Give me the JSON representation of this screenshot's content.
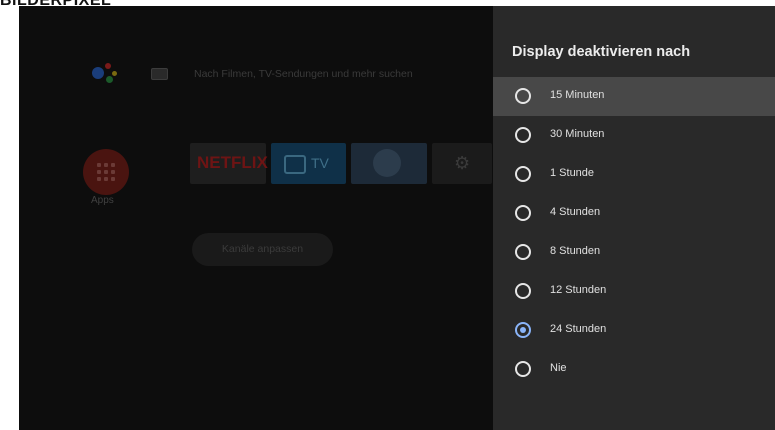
{
  "top_text": "BILDERPIXEL",
  "launcher": {
    "search_hint": "Nach Filmen, TV-Sendungen und mehr suchen",
    "apps_label": "Apps",
    "tiles": {
      "netflix": "NETFLIX",
      "tv": "TV"
    },
    "channels_button": "Kanäle anpassen"
  },
  "panel": {
    "title": "Display deaktivieren nach",
    "options": [
      {
        "label": "15 Minuten",
        "checked": false,
        "focused": true
      },
      {
        "label": "30 Minuten",
        "checked": false,
        "focused": false
      },
      {
        "label": "1 Stunde",
        "checked": false,
        "focused": false
      },
      {
        "label": "4 Stunden",
        "checked": false,
        "focused": false
      },
      {
        "label": "8 Stunden",
        "checked": false,
        "focused": false
      },
      {
        "label": "12 Stunden",
        "checked": false,
        "focused": false
      },
      {
        "label": "24 Stunden",
        "checked": true,
        "focused": false
      },
      {
        "label": "Nie",
        "checked": false,
        "focused": false
      }
    ]
  },
  "colors": {
    "accent": "#8ab4f8",
    "panel_bg": "#292929",
    "focus_bg": "#484848"
  }
}
